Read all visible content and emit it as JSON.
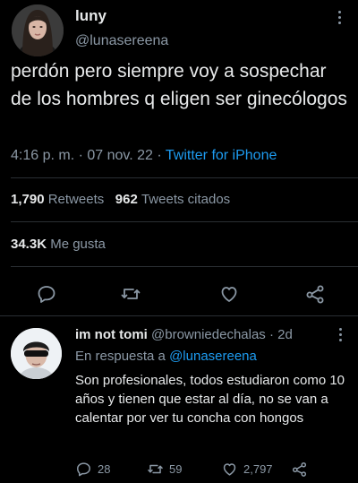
{
  "tweet": {
    "display_name": "luny",
    "handle": "@lunasereena",
    "text": "perdón pero siempre voy a sospechar de los hombres q eligen ser ginecólogos",
    "time": "4:16 p. m.",
    "date_sep": "·",
    "date": "07 nov. 22",
    "source": "Twitter for iPhone",
    "retweets_count": "1,790",
    "retweets_label": "Retweets",
    "quotes_count": "962",
    "quotes_label": "Tweets citados",
    "likes_count": "34.3K",
    "likes_label": "Me gusta"
  },
  "reply": {
    "display_name": "im not tomi",
    "handle": "@browniedechalas",
    "time_sep": "·",
    "time": "2d",
    "reply_to_label": "En respuesta a",
    "reply_to_handle": "@lunasereena",
    "text": "Son profesionales, todos estudiaron como 10 años y tienen que estar al día, no se van a calentar por ver tu concha con hongos",
    "replies": "28",
    "retweets": "59",
    "likes": "2,797"
  },
  "icons": [
    "reply-icon",
    "retweet-icon",
    "like-icon",
    "share-icon",
    "more-icon"
  ],
  "colors": {
    "background": "#000000",
    "text": "#e7e9ea",
    "secondary": "#8b98a5",
    "accent": "#1d9bf0"
  }
}
